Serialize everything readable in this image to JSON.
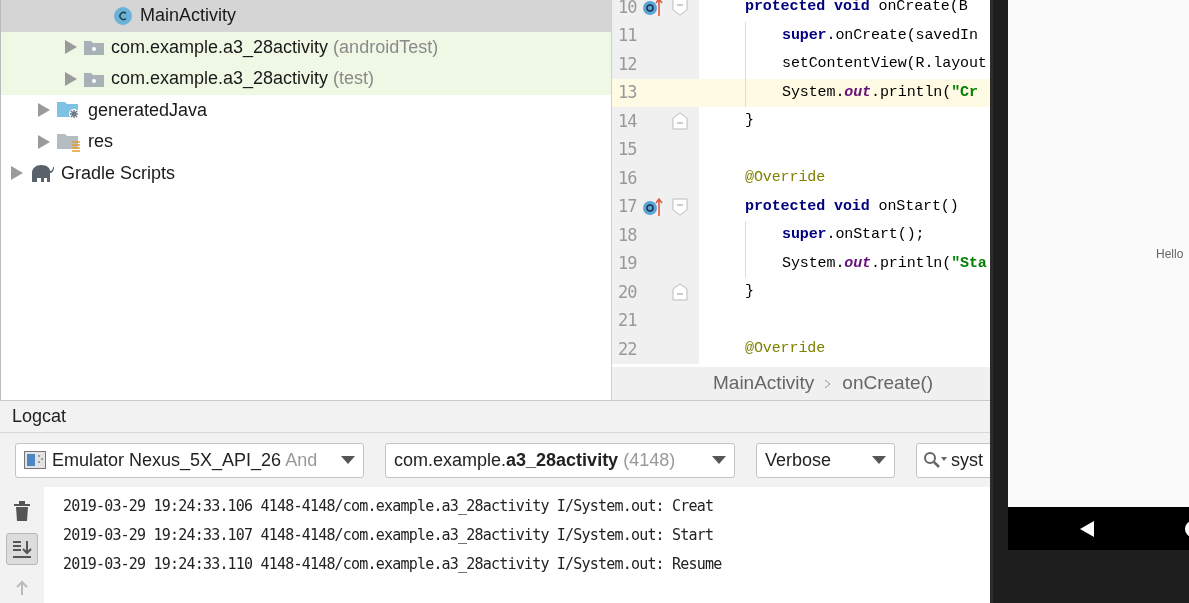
{
  "project_tree": [
    {
      "children": [
        {
          "children": [
            {
              "children": [
                {
                  "label": "MainActivity",
                  "kind": "class",
                  "selected": true
                }
              ]
            },
            {
              "label": "com.example.a3_28activity",
              "suffix": "(androidTest)",
              "kind": "package",
              "expanded": false,
              "selected": false,
              "test_scope": true
            },
            {
              "label": "com.example.a3_28activity",
              "suffix": "(test)",
              "kind": "package",
              "expanded": false,
              "selected": false,
              "test_scope": true
            }
          ]
        },
        {
          "label": "generatedJava",
          "kind": "generated_folder",
          "expanded": false,
          "selected": false,
          "test_scope": false
        },
        {
          "label": "res",
          "kind": "resource_folder",
          "expanded": false,
          "selected": false,
          "test_scope": false
        }
      ]
    },
    {
      "label": "Gradle Scripts",
      "kind": "gradle",
      "expanded": false,
      "selected": false,
      "test_scope": false
    }
  ],
  "editor": {
    "lines": [
      {
        "number": "10",
        "overrides": true,
        "fold_start": true,
        "current": false,
        "indented": false,
        "tokens": [
          {
            "text": "protected void",
            "kind": "keyword"
          },
          {
            "text": " onCreate(B",
            "kind": "plain"
          }
        ]
      },
      {
        "number": "11",
        "current": false,
        "indented": true,
        "tokens": [
          {
            "text": "super",
            "kind": "keyword"
          },
          {
            "text": ".onCreate(savedIn",
            "kind": "plain"
          }
        ]
      },
      {
        "number": "12",
        "current": false,
        "indented": true,
        "tokens": [
          {
            "text": "setContentView(R.layout",
            "kind": "plain"
          }
        ]
      },
      {
        "number": "13",
        "current": true,
        "indented": true,
        "tokens": [
          {
            "text": "System.",
            "kind": "plain"
          },
          {
            "text": "out",
            "kind": "static"
          },
          {
            "text": ".println(",
            "kind": "plain"
          },
          {
            "text": "\"Cr",
            "kind": "string"
          }
        ]
      },
      {
        "number": "14",
        "fold_end": true,
        "current": false,
        "indented": false,
        "tokens": [
          {
            "text": "}",
            "kind": "plain"
          }
        ]
      },
      {
        "number": "15",
        "current": false,
        "indented": false
      },
      {
        "number": "16",
        "current": false,
        "indented": false,
        "tokens": [
          {
            "text": "@Override",
            "kind": "annotation"
          }
        ]
      },
      {
        "number": "17",
        "overrides": true,
        "fold_start": true,
        "current": false,
        "indented": false,
        "tokens": [
          {
            "text": "protected void",
            "kind": "keyword"
          },
          {
            "text": " onStart()",
            "kind": "plain"
          }
        ]
      },
      {
        "number": "18",
        "current": false,
        "indented": true,
        "tokens": [
          {
            "text": "super",
            "kind": "keyword"
          },
          {
            "text": ".onStart();",
            "kind": "plain"
          }
        ]
      },
      {
        "number": "19",
        "current": false,
        "indented": true,
        "tokens": [
          {
            "text": "System.",
            "kind": "plain"
          },
          {
            "text": "out",
            "kind": "static"
          },
          {
            "text": ".println(",
            "kind": "plain"
          },
          {
            "text": "\"Sta",
            "kind": "string"
          }
        ]
      },
      {
        "number": "20",
        "fold_end": true,
        "current": false,
        "indented": false,
        "tokens": [
          {
            "text": "}",
            "kind": "plain"
          }
        ]
      },
      {
        "number": "21",
        "current": false,
        "indented": false
      },
      {
        "number": "22",
        "current": false,
        "indented": false,
        "tokens": [
          {
            "text": "@Override",
            "kind": "annotation"
          }
        ]
      }
    ],
    "breadcrumb": [
      "MainActivity",
      "onCreate()"
    ]
  },
  "logcat": {
    "title": "Logcat",
    "device": {
      "name": "Emulator Nexus_5X_API_26",
      "extra": "And"
    },
    "process": {
      "name": "com.example.**a3_28activity**",
      "pid": "(4148)"
    },
    "level": "Verbose",
    "search": {
      "value": "syst"
    },
    "tools": [
      {
        "kind": "trash",
        "selected": false
      },
      {
        "kind": "scroll_end",
        "selected": true
      },
      {
        "kind": "up",
        "selected": false
      }
    ],
    "lines": [
      "2019-03-29 19:24:33.106 4148-4148/com.example.a3_28activity I/System.out: Creat",
      "2019-03-29 19:24:33.107 4148-4148/com.example.a3_28activity I/System.out: Start",
      "2019-03-29 19:24:33.110 4148-4148/com.example.a3_28activity I/System.out: Resume"
    ]
  },
  "emulator": {
    "screen_text": "Hello"
  }
}
